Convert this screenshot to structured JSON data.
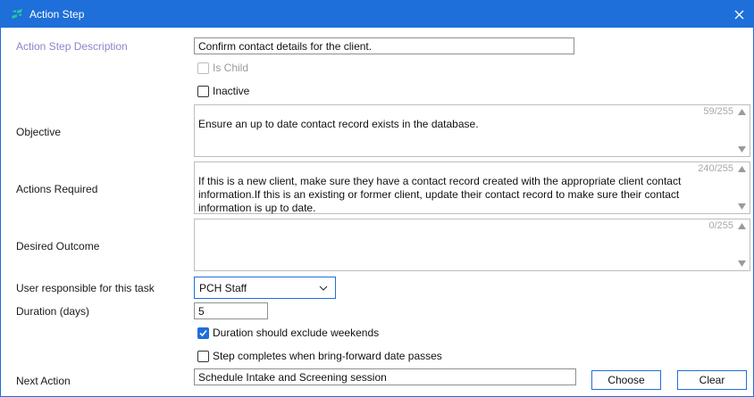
{
  "window": {
    "title": "Action Step",
    "accent_color": "#1e6fd9",
    "icon": "app-logo-icon"
  },
  "form": {
    "description": {
      "label": "Action Step Description",
      "value": "Confirm contact details for the client."
    },
    "is_child": {
      "label": "Is Child",
      "checked": false,
      "disabled": true
    },
    "inactive": {
      "label": "Inactive",
      "checked": false
    },
    "objective": {
      "label": "Objective",
      "value": "Ensure an up to date contact record exists in the database.",
      "counter": "59/255"
    },
    "actions_required": {
      "label": "Actions Required",
      "value": "If this is a new client, make sure they have a contact record created with the appropriate client contact information.If this is an existing or former client, update their contact record to make sure their contact information is up to date.",
      "counter": "240/255"
    },
    "desired_outcome": {
      "label": "Desired Outcome",
      "value": "",
      "counter": "0/255"
    },
    "user_responsible": {
      "label": "User responsible for this task",
      "value": "PCH Staff"
    },
    "duration": {
      "label": "Duration (days)",
      "value": "5"
    },
    "exclude_weekends": {
      "label": "Duration should exclude weekends",
      "checked": true
    },
    "step_completes": {
      "label": "Step completes when bring-forward date passes",
      "checked": false
    },
    "next_action": {
      "label": "Next Action",
      "value": "Schedule Intake and Screening session"
    },
    "buttons": {
      "choose": "Choose",
      "clear": "Clear"
    }
  }
}
